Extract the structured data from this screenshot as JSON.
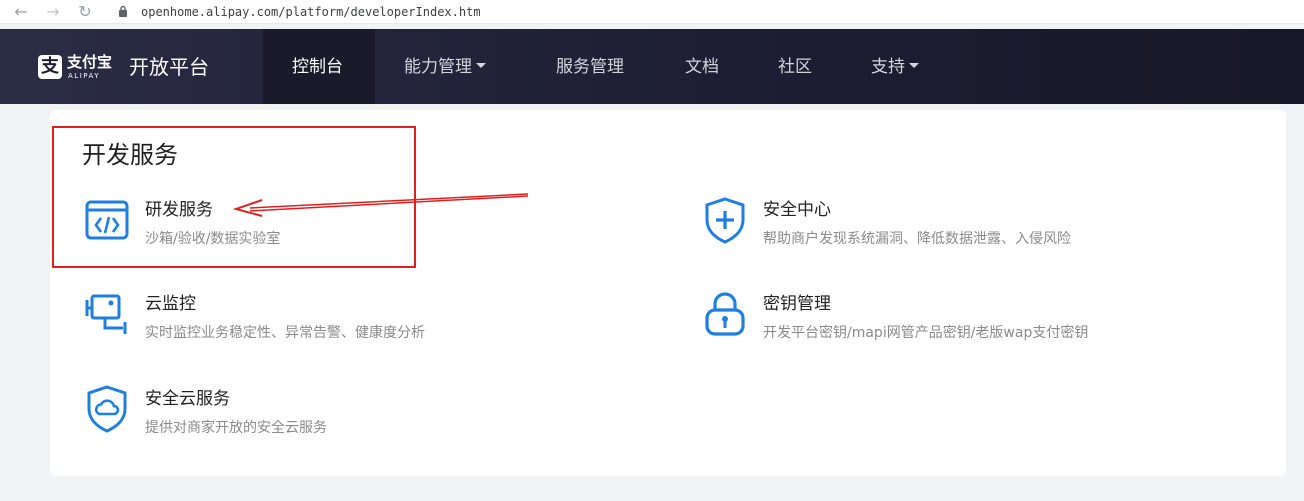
{
  "browser": {
    "url": "openhome.alipay.com/platform/developerIndex.htm"
  },
  "header": {
    "logo_text": "支付宝",
    "logo_sub": "ALIPAY",
    "platform_title": "开放平台",
    "nav": [
      {
        "label": "控制台",
        "active": true
      },
      {
        "label": "能力管理",
        "dropdown": true
      },
      {
        "label": "服务管理"
      },
      {
        "label": "文档"
      },
      {
        "label": "社区"
      },
      {
        "label": "支持",
        "dropdown": true
      }
    ]
  },
  "main": {
    "section_title": "开发服务",
    "services": [
      {
        "title": "研发服务",
        "desc": "沙箱/验收/数据实验室",
        "icon": "code-window-icon"
      },
      {
        "title": "安全中心",
        "desc": "帮助商户发现系统漏洞、降低数据泄露、入侵风险",
        "icon": "shield-plus-icon"
      },
      {
        "title": "云监控",
        "desc": "实时监控业务稳定性、异常告警、健康度分析",
        "icon": "monitor-camera-icon"
      },
      {
        "title": "密钥管理",
        "desc": "开发平台密钥/mapi网管产品密钥/老版wap支付密钥",
        "icon": "lock-icon"
      },
      {
        "title": "安全云服务",
        "desc": "提供对商家开放的安全云服务",
        "icon": "shield-cloud-icon"
      }
    ]
  },
  "colors": {
    "accent_blue": "#1e7fe0",
    "nav_bg": "#1d1e33",
    "annotation_red": "#e02020"
  }
}
